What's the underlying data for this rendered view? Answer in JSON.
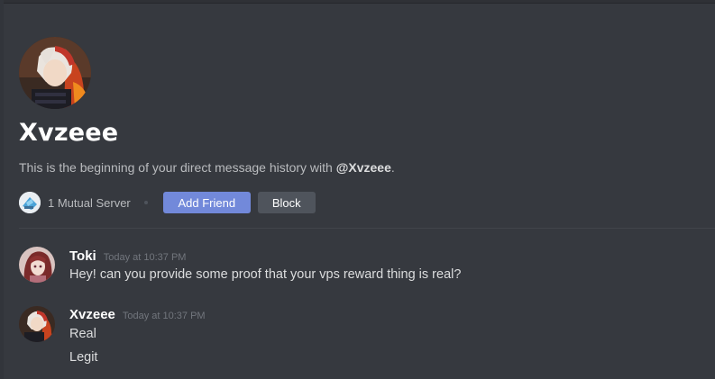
{
  "dm_header": {
    "name": "Xvzeee",
    "intro_prefix": "This is the beginning of your direct message history with ",
    "intro_mention": "@Xvzeee",
    "intro_suffix": ".",
    "mutual_servers": "1 Mutual Server",
    "add_friend_label": "Add Friend",
    "block_label": "Block"
  },
  "messages": [
    {
      "author": "Toki",
      "timestamp": "Today at 10:37 PM",
      "lines": [
        "Hey! can you provide some proof that your vps reward thing is real?"
      ]
    },
    {
      "author": "Xvzeee",
      "timestamp": "Today at 10:37 PM",
      "lines": [
        "Real",
        "Legit"
      ]
    }
  ],
  "colors": {
    "background": "#36393f",
    "accent": "#7289da",
    "secondary_button": "#4f545c",
    "name": "#ffffff",
    "muted_text": "#b9bbbe",
    "timestamp": "#72767d"
  }
}
